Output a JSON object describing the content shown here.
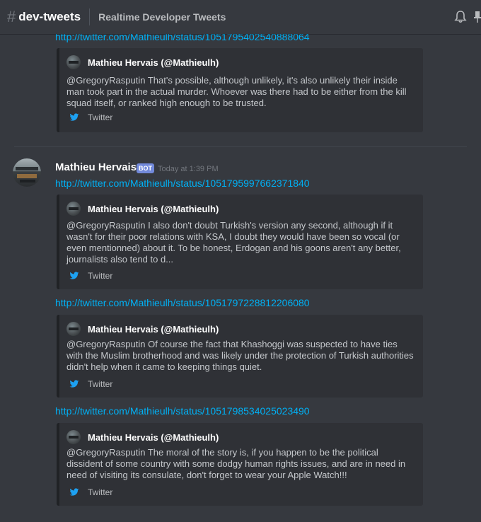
{
  "header": {
    "hash": "#",
    "channel_name": "dev-tweets",
    "topic": "Realtime Developer Tweets"
  },
  "messages": {
    "prev_link": "http://twitter.com/Mathieulh/status/1051795402540888064",
    "prev_embed": {
      "author": "Mathieu Hervais (@Mathieulh)",
      "description": "@GregoryRasputin That's possible, although unlikely, it's also unlikely their inside man took part in the actual murder. Whoever was there had to be either from the kill squad itself, or ranked high enough to be trusted.",
      "footer": "Twitter"
    },
    "author": {
      "name": "Mathieu Hervais",
      "tag": "BOT",
      "timestamp": "Today at 1:39 PM"
    },
    "items": [
      {
        "link": "http://twitter.com/Mathieulh/status/1051795997662371840",
        "embed": {
          "author": "Mathieu Hervais (@Mathieulh)",
          "description": "@GregoryRasputin I also don't doubt Turkish's version any second, although if it wasn't for their poor relations with KSA, I doubt they would have been so vocal (or even mentionned) about it. To be honest, Erdogan and his goons aren't any better, journalists also tend to d...",
          "footer": "Twitter"
        }
      },
      {
        "link": "http://twitter.com/Mathieulh/status/1051797228812206080",
        "embed": {
          "author": "Mathieu Hervais (@Mathieulh)",
          "description": "@GregoryRasputin Of course the fact that Khashoggi was suspected to have ties with the Muslim brotherhood and was likely under the protection of Turkish authorities didn't help when it came to keeping things quiet.",
          "footer": "Twitter"
        }
      },
      {
        "link": "http://twitter.com/Mathieulh/status/1051798534025023490",
        "embed": {
          "author": "Mathieu Hervais (@Mathieulh)",
          "description": "@GregoryRasputin The moral of the story is, if you happen to be the political dissident of some country with some dodgy human rights issues, and are in need in need of visiting its consulate, don't forget to wear your Apple Watch!!!",
          "footer": "Twitter"
        }
      }
    ]
  },
  "colors": {
    "background": "#36393f",
    "embed_background": "#2f3136",
    "link": "#00b0f4",
    "bot_tag": "#7289da",
    "twitter_blue": "#1da1f2"
  },
  "icons": {
    "bell": "bell-icon",
    "pin": "pin-icon",
    "twitter": "twitter-icon"
  }
}
